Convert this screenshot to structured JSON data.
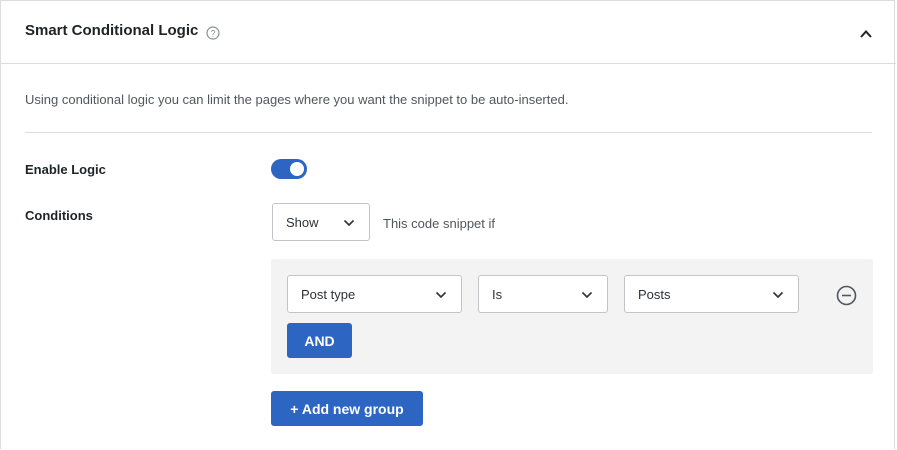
{
  "panel": {
    "title": "Smart Conditional Logic",
    "description": "Using conditional logic you can limit the pages where you want the snippet to be auto-inserted."
  },
  "enable_logic": {
    "label": "Enable Logic",
    "enabled": true
  },
  "conditions": {
    "label": "Conditions",
    "mode_value": "Show",
    "mode_hint": "This code snippet if",
    "rule": {
      "field": "Post type",
      "operator": "Is",
      "value": "Posts"
    },
    "and_label": "AND",
    "add_group_label": "+ Add new group"
  },
  "colors": {
    "accent": "#2d65c3",
    "group_bg": "#f3f3f3",
    "border": "#dcdcde"
  }
}
